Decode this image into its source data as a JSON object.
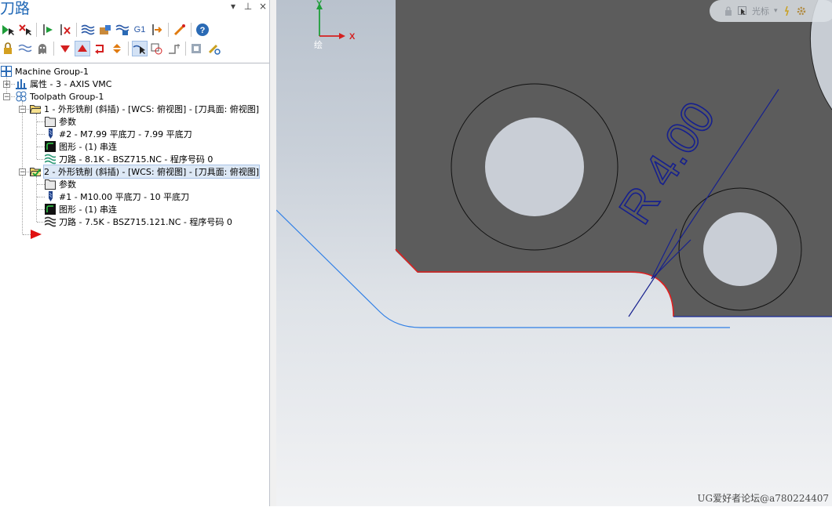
{
  "panel": {
    "title": "刀路",
    "controls": [
      "▾",
      "⊥",
      "×"
    ]
  },
  "toolbar": {
    "row1": [
      "select-all-icon",
      "deselect-icon",
      "regen-icon",
      "regen-dirty-icon",
      "backplot-icon",
      "verify-icon",
      "simulate-icon",
      "g1-icon",
      "post-icon",
      "wizard-icon",
      "help-icon"
    ],
    "row1_g1_label": "G1",
    "row2": [
      "lock-icon",
      "toolpath-display-icon",
      "ghost-icon",
      "move-down-icon",
      "move-up-icon",
      "insert-arrow-icon",
      "expand-collapse-icon",
      "select-mode-icon",
      "geometry-icon",
      "dimension-icon",
      "highfeed-icon",
      "edit-icon"
    ]
  },
  "tree": {
    "machine_group": "Machine Group-1",
    "properties": "属性 - 3 - AXIS VMC",
    "toolpath_group": "Toolpath Group-1",
    "ops": [
      {
        "label": "1 - 外形铣削 (斜插) - [WCS: 俯视图] - [刀具面: 俯视图]",
        "params": "参数",
        "tool": "#2 - M7.99 平底刀 - 7.99 平底刀",
        "geometry": "图形 - (1) 串连",
        "toolpath": "刀路 - 8.1K - BSZ715.NC - 程序号码 0"
      },
      {
        "label": "2 - 外形铣削 (斜插) - [WCS: 俯视图] - [刀具面: 俯视图]",
        "params": "参数",
        "tool": "#1 - M10.00 平底刀 - 10 平底刀",
        "geometry": "图形 - (1) 串连",
        "toolpath": "刀路 - 7.5K - BSZ715.121.NC - 程序号码 0"
      }
    ]
  },
  "viewport": {
    "axis_y": "Y",
    "axis_x": "X",
    "view_label": "绘",
    "dimension": "R 4.00",
    "cursor_label": "光标",
    "watermark": "UG爱好者论坛@a780224407"
  },
  "colors": {
    "part_fill": "#5c5c5c",
    "part_edge_red": "#e02020",
    "toolpath_blue": "#2f7fe6",
    "dimension_navy": "#16208e",
    "panel_title": "#1e66b5"
  }
}
